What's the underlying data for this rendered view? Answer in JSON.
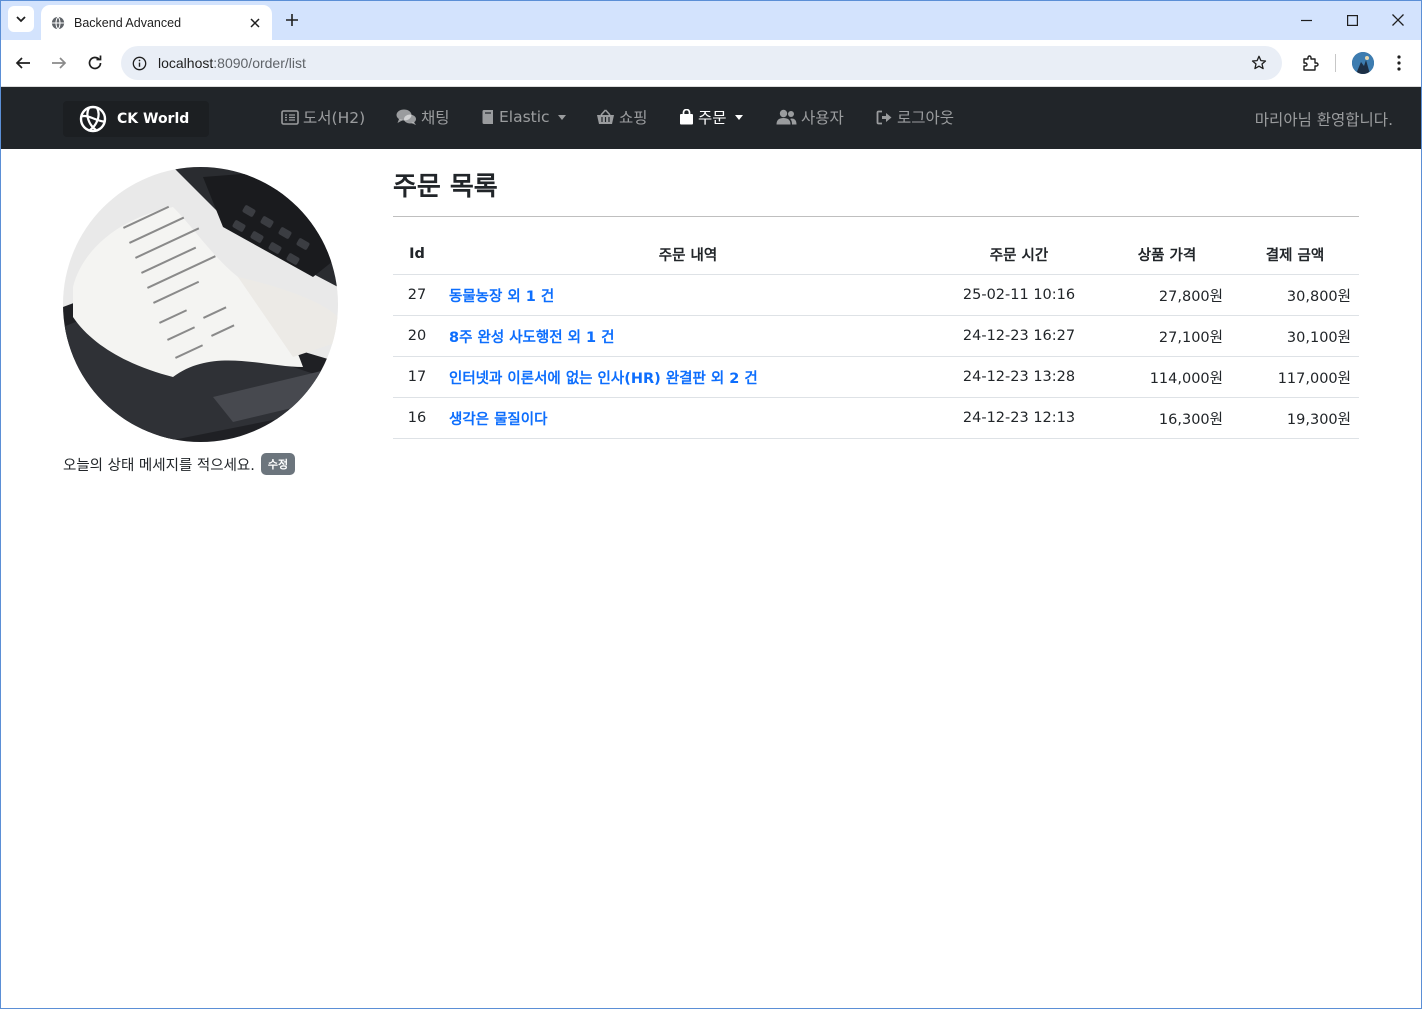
{
  "browser": {
    "tab_title": "Backend Advanced",
    "url_host": "localhost",
    "url_rest": ":8090/order/list"
  },
  "navbar": {
    "brand": "CK World",
    "items": [
      {
        "label": "도서(H2)",
        "icon": "list-icon"
      },
      {
        "label": "채팅",
        "icon": "comments-icon"
      },
      {
        "label": "Elastic",
        "icon": "book-icon",
        "dropdown": true
      },
      {
        "label": "쇼핑",
        "icon": "basket-icon"
      },
      {
        "label": "주문",
        "icon": "shopping-bag-icon",
        "dropdown": true,
        "active": true
      },
      {
        "label": "사용자",
        "icon": "users-icon"
      },
      {
        "label": "로그아웃",
        "icon": "logout-icon"
      }
    ],
    "welcome": "마리아님 환영합니다."
  },
  "sidebar": {
    "avatar_alt": "receipt photo",
    "status_message": "오늘의 상태 메세지를 적으세요.",
    "edit_label": "수정"
  },
  "main": {
    "title": "주문 목록",
    "table": {
      "headers": [
        "Id",
        "주문 내역",
        "주문 시간",
        "상품 가격",
        "결제 금액"
      ],
      "rows": [
        {
          "id": "27",
          "desc": "동물농장 외 1 건",
          "time": "25-02-11 10:16",
          "price": "27,800원",
          "total": "30,800원"
        },
        {
          "id": "20",
          "desc": "8주 완성 사도행전 외 1 건",
          "time": "24-12-23 16:27",
          "price": "27,100원",
          "total": "30,100원"
        },
        {
          "id": "17",
          "desc": "인터넷과 이론서에 없는 인사(HR) 완결판 외 2 건",
          "time": "24-12-23 13:28",
          "price": "114,000원",
          "total": "117,000원"
        },
        {
          "id": "16",
          "desc": "생각은 물질이다",
          "time": "24-12-23 12:13",
          "price": "16,300원",
          "total": "19,300원"
        }
      ]
    }
  },
  "colors": {
    "navbar_bg": "#212529",
    "link": "#0d6efd",
    "badge": "#6c757d",
    "tabstrip": "#d3e3fd"
  }
}
